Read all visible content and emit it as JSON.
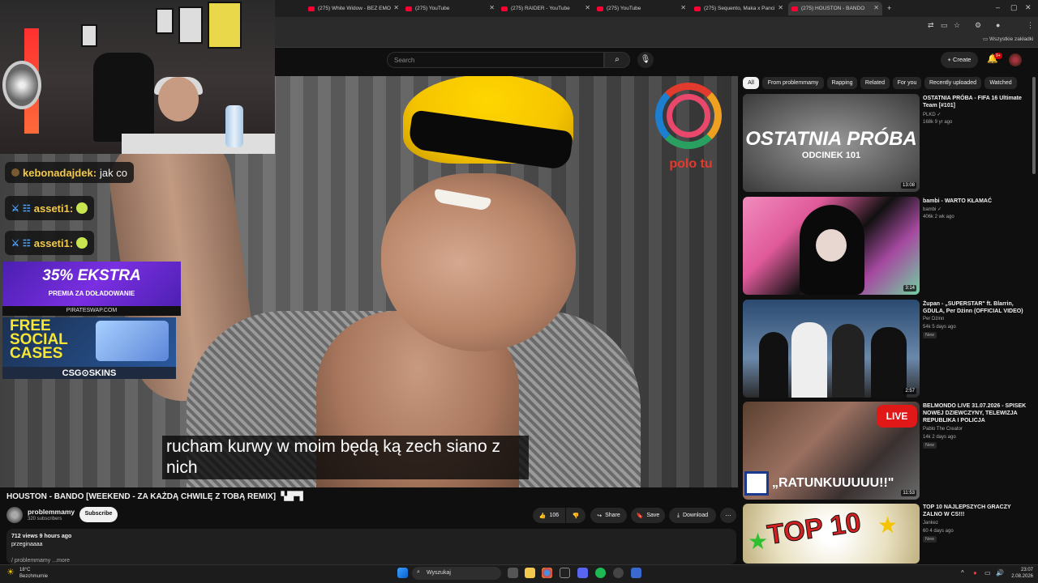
{
  "browser": {
    "tabs": [
      {
        "title": "(275) White Widow - BEZ EMO"
      },
      {
        "title": "(275) YouTube"
      },
      {
        "title": "(275) RAIDER - YouTube"
      },
      {
        "title": "(275) YouTube"
      },
      {
        "title": "(275) Sequento, Maka x Panci"
      },
      {
        "title": "(275) HOUSTON - BANDO"
      }
    ],
    "bookmarks_label": "Wszystkie zakładki"
  },
  "youtube": {
    "search_placeholder": "Search",
    "create_label": "Create",
    "notif_count": "9+"
  },
  "video": {
    "subtitle": "rucham kurwy w moim będą ką zech siano z nich",
    "logo_text": "polo tu",
    "title": "HOUSTON - BANDO [WEEKEND - ZA KAŻDĄ CHWILĘ Z TOBĄ REMIX] ▝▟▛▜",
    "channel": "problemmamy",
    "subs": "320 subscribers",
    "subscribe_label": "Subscribe",
    "likes": "106",
    "share_label": "Share",
    "save_label": "Save",
    "download_label": "Download",
    "views": "712 views  9 hours ago",
    "desc_text": "przeginaaaa",
    "desc_more": "/ problemmamy   ...more"
  },
  "overlay": {
    "chat": [
      {
        "user": "kebonadajdek:",
        "text": "jak co"
      },
      {
        "user": "asseti1:",
        "text": ""
      },
      {
        "user": "asseti1:",
        "text": ""
      }
    ],
    "ad1_main": "35% EKSTRA",
    "ad1_sub": "PREMIA ZA DOŁADOWANIE",
    "ad1_site": "PIRATESWAP.COM",
    "ad2_main": "FREE SOCIAL CASES",
    "ad2_brand": "CSG⊙SKINS"
  },
  "chips": [
    "All",
    "From problemmamy",
    "Rapping",
    "Related",
    "For you",
    "Recently uploaded",
    "Watched"
  ],
  "recommendations": [
    {
      "thumb_title": "OSTATNIA PRÓBA",
      "thumb_sub": "ODCINEK 101",
      "title": "OSTATNIA PRÓBA - FIFA 16 Ultimate Team [#101]",
      "channel": "PLKD ✓",
      "meta": "168k  9 yr ago",
      "duration": "13:08",
      "new": ""
    },
    {
      "thumb_title": "",
      "thumb_sub": "",
      "title": "bambi - WARTO KŁAMAĆ",
      "channel": "bambi ✓",
      "meta": "406k  2 wk ago",
      "duration": "3:14",
      "new": ""
    },
    {
      "thumb_title": "",
      "thumb_sub": "",
      "title": "Żupan - „SUPERSTAR\" ft. Blarrin, GDULA, Per Dżinn (OFFICIAL VIDEO)",
      "channel": "Per Dżinn",
      "meta": "54k  5 days ago",
      "duration": "2:57",
      "new": "New"
    },
    {
      "thumb_title": "„RATUNKUUUUU!!\"",
      "thumb_sub": "LIVE",
      "title": "BELMONDO LIVE 31.07.2026 - SPISEK NOWEJ DZIEWCZYNY, TELEWIZJA REPUBLIKA I POLICJA",
      "channel": "Pablo The Creator",
      "meta": "14k  2 days ago",
      "duration": "11:53",
      "new": "New"
    },
    {
      "thumb_title": "TOP 10",
      "thumb_sub": "",
      "title": "TOP 10 NAJLEPSZYCH GRACZY ZALNO W CS!!!",
      "channel": "Jankez",
      "meta": "60  4 days ago",
      "duration": "",
      "new": "New"
    }
  ],
  "taskbar": {
    "temp": "18°C",
    "weather": "Bezchmurnie",
    "search": "Wyszukaj",
    "time": "23:07",
    "date": "2.08.2026"
  }
}
